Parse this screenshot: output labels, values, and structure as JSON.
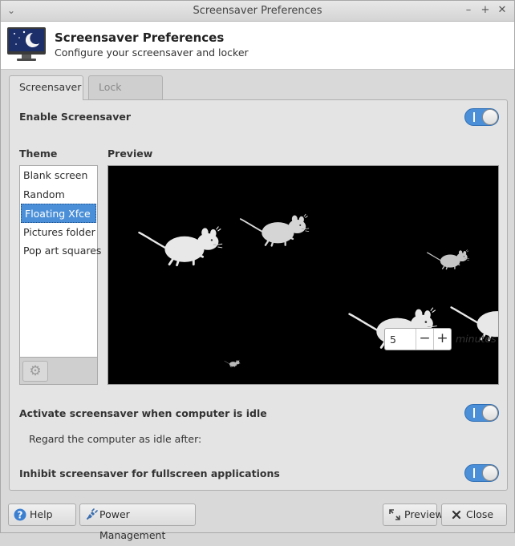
{
  "window": {
    "title": "Screensaver Preferences",
    "minimize_glyph": "–",
    "maximize_glyph": "+",
    "close_glyph": "✕"
  },
  "header": {
    "title": "Screensaver Preferences",
    "subtitle": "Configure your screensaver and locker",
    "icon": "screensaver-moon-icon"
  },
  "tabs": [
    {
      "label": "Screensaver",
      "active": true
    },
    {
      "label": "Lock Screen",
      "active": false
    }
  ],
  "screensaver": {
    "enable_label": "Enable Screensaver",
    "enable_value": true,
    "theme_heading": "Theme",
    "preview_heading": "Preview",
    "themes": [
      {
        "label": "Blank screen"
      },
      {
        "label": "Random"
      },
      {
        "label": "Floating Xfce",
        "selected": true
      },
      {
        "label": "Pictures folder"
      },
      {
        "label": "Pop art squares"
      }
    ],
    "theme_settings_icon": "gear-icon",
    "activate_label": "Activate screensaver when computer is idle",
    "activate_value": true,
    "idle_label": "Regard the computer as idle after:",
    "idle_value": "5",
    "idle_unit": "minutes",
    "inhibit_label": "Inhibit screensaver for fullscreen applications",
    "inhibit_value": true
  },
  "buttons": {
    "help": "Help",
    "power": "Power Management",
    "preview": "Preview",
    "close": "Close"
  },
  "colors": {
    "accent": "#4a8fd8",
    "preview_bg": "#000000",
    "mouse_fill": "#e8e8e8"
  }
}
